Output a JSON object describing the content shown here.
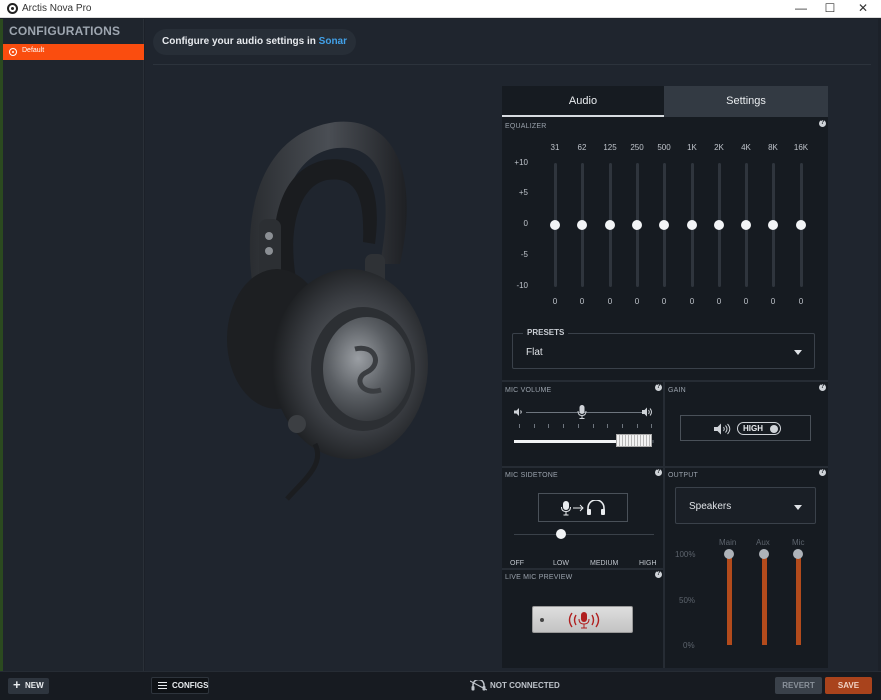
{
  "window": {
    "title": "Arctis Nova Pro",
    "minimize": "—",
    "maximize": "☐",
    "close": "✕"
  },
  "sidebar": {
    "title": "CONFIGURATIONS",
    "items": [
      {
        "label": "Default",
        "active": true
      }
    ]
  },
  "banner": {
    "text": "Configure your audio settings in ",
    "link": "Sonar"
  },
  "tabs": [
    {
      "label": "Audio",
      "active": true
    },
    {
      "label": "Settings",
      "active": false
    }
  ],
  "equalizer": {
    "label": "EQUALIZER",
    "help": "?",
    "frequencies": [
      "31",
      "62",
      "125",
      "250",
      "500",
      "1K",
      "2K",
      "4K",
      "8K",
      "16K"
    ],
    "db_scale": [
      "+10",
      "+5",
      "0",
      "-5",
      "-10"
    ],
    "values": [
      "0",
      "0",
      "0",
      "0",
      "0",
      "0",
      "0",
      "0",
      "0",
      "0"
    ]
  },
  "presets": {
    "label": "PRESETS",
    "value": "Flat"
  },
  "mic_volume": {
    "label": "MIC VOLUME",
    "help": "?",
    "level": 0.75
  },
  "gain": {
    "label": "GAIN",
    "help": "?",
    "value": "HIGH"
  },
  "mic_sidetone": {
    "label": "MIC SIDETONE",
    "help": "?",
    "options": [
      "OFF",
      "LOW",
      "MEDIUM",
      "HIGH"
    ],
    "selected": "LOW"
  },
  "output": {
    "label": "OUTPUT",
    "help": "?",
    "value": "Speakers",
    "channels": [
      {
        "label": "Main",
        "level": 1.0
      },
      {
        "label": "Aux",
        "level": 1.0
      },
      {
        "label": "Mic",
        "level": 1.0
      }
    ],
    "scale": [
      "100%",
      "50%",
      "0%"
    ]
  },
  "live_mic_preview": {
    "label": "LIVE MIC PREVIEW",
    "help": "?"
  },
  "footer": {
    "new_label": "NEW",
    "configs_label": "CONFIGS",
    "status": "NOT CONNECTED",
    "revert_label": "REVERT",
    "save_label": "SAVE"
  },
  "colors": {
    "accent": "#fa4d0f",
    "link": "#42a1e8",
    "save": "#a9431c",
    "mixer": "#b34b1c"
  }
}
